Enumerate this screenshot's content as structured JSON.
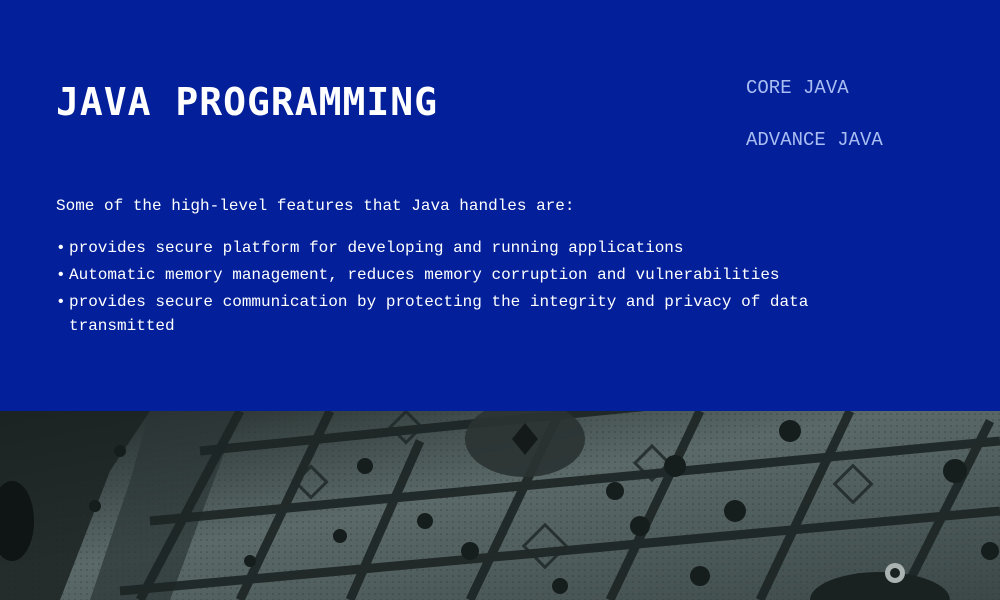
{
  "header": {
    "title": "JAVA PROGRAMMING"
  },
  "nav": {
    "items": [
      {
        "label": "CORE JAVA"
      },
      {
        "label": "ADVANCE JAVA"
      }
    ]
  },
  "content": {
    "intro": "Some of the high-level features that Java handles are:",
    "bullet_glyph": "•",
    "features": [
      "provides secure platform for developing and running applications",
      "Automatic memory management, reduces memory corruption and vulnerabilities",
      "provides secure communication by protecting the integrity and privacy of data transmitted"
    ]
  },
  "colors": {
    "panel_background": "#03209a",
    "nav_link": "#a9bdf2",
    "text": "#ffffff",
    "image_tone": "#3d4a4a"
  }
}
